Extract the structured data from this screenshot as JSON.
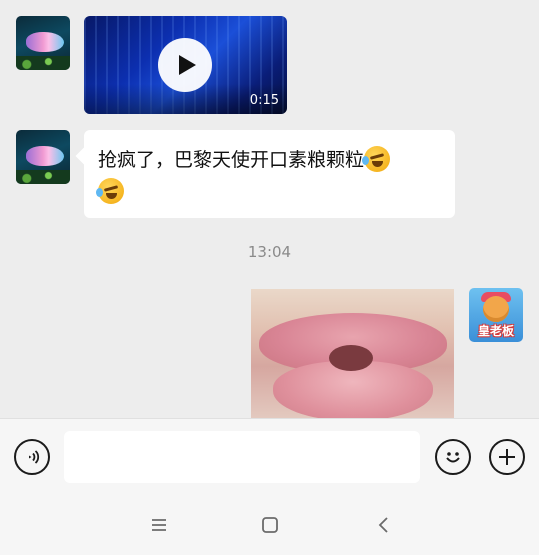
{
  "chat": {
    "video_message": {
      "duration": "0:15",
      "icon": "play-icon"
    },
    "text_message": {
      "text": "抢疯了，巴黎天使开口素粮颗粒",
      "emoji": "rolling-laughing-emoji"
    },
    "timestamp": "13:04",
    "image_message": {
      "subject": "lips-photo"
    },
    "self_avatar": {
      "label": "皇老板"
    }
  },
  "input_bar": {
    "voice_icon": "voice-icon",
    "text_value": "",
    "emoji_icon": "smiley-icon",
    "plus_icon": "plus-icon"
  },
  "nav_bar": {
    "menu_icon": "menu-icon",
    "home_icon": "home-square-icon",
    "back_icon": "back-chevron-icon"
  }
}
